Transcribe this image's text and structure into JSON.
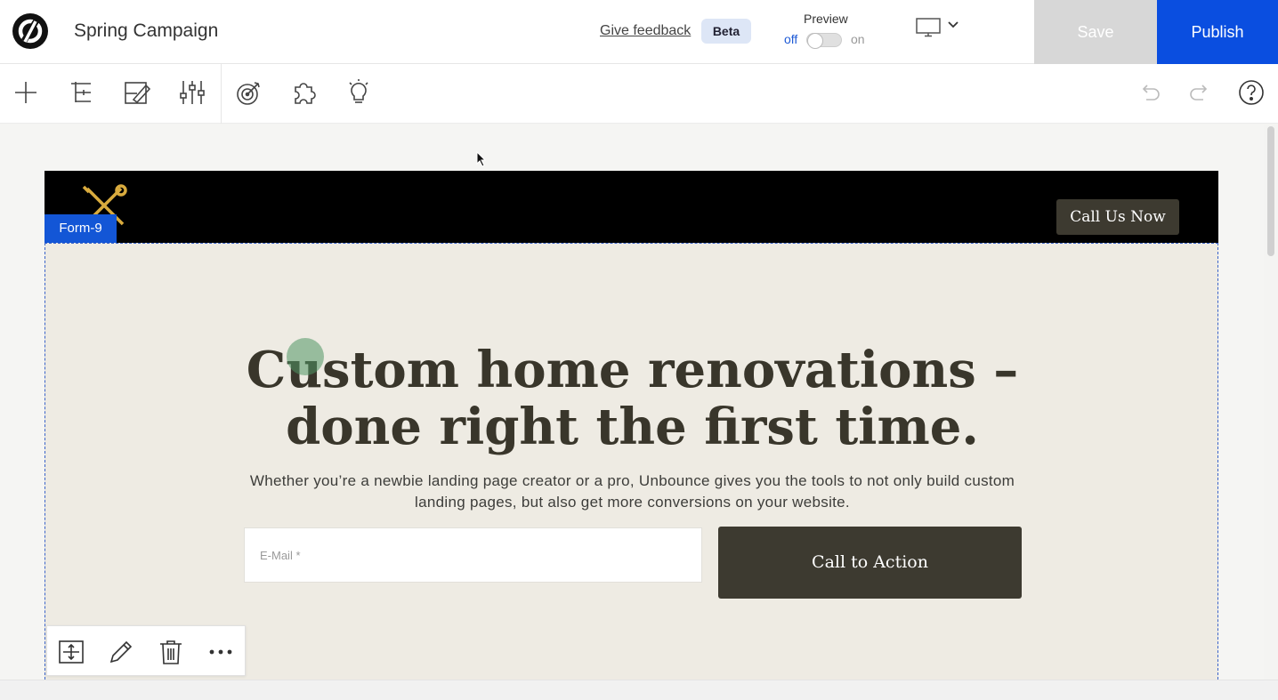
{
  "app": {
    "project_title": "Spring Campaign",
    "feedback_link": "Give feedback",
    "beta_badge": "Beta",
    "preview": {
      "label": "Preview",
      "off": "off",
      "on": "on",
      "state": "off"
    },
    "device_icon": "desktop-monitor-icon",
    "save_label": "Save",
    "publish_label": "Publish",
    "colors": {
      "publish": "#0a4ee0",
      "save_disabled": "#d7d7d7",
      "selection": "#1356d6"
    }
  },
  "toolbar": {
    "tools": [
      "plus-icon",
      "page-tree-icon",
      "style-edit-icon",
      "settings-sliders-icon",
      "goal-target-icon",
      "integrations-puzzle-icon",
      "tips-lightbulb-icon"
    ],
    "right": [
      "undo-icon",
      "redo-icon",
      "help-icon"
    ]
  },
  "landing_page": {
    "header_button": "Call Us Now",
    "selected_tag": "Form-9",
    "headline": "Custom home renovations – done right the first time.",
    "subtext": "Whether you’re a newbie landing page creator or a pro, Unbounce gives you the tools to not only build custom landing pages, but also get more conversions on your website.",
    "email_placeholder": "E-Mail *",
    "cta_label": "Call to Action"
  },
  "element_toolbar": [
    "resize-icon",
    "pencil-icon",
    "trash-icon",
    "more-icon"
  ]
}
